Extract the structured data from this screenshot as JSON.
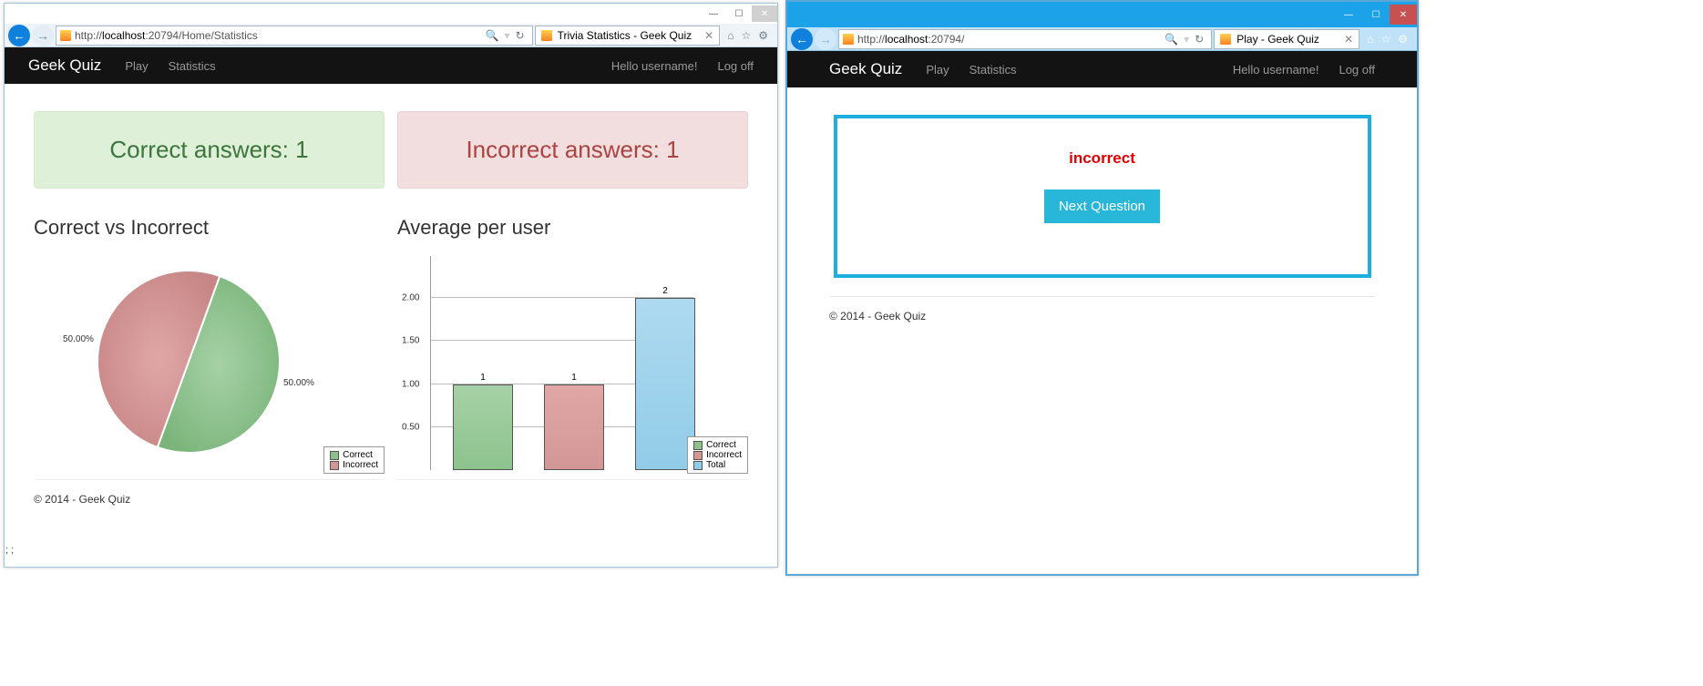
{
  "left_window": {
    "url_prefix": "http://",
    "url_host": "localhost",
    "url_rest": ":20794/Home/Statistics",
    "tab_title": "Trivia Statistics - Geek Quiz",
    "navbar": {
      "brand": "Geek Quiz",
      "play": "Play",
      "stats": "Statistics",
      "greeting": "Hello username!",
      "logoff": "Log off"
    },
    "correct_label": "Correct answers: 1",
    "incorrect_label": "Incorrect answers: 1",
    "pie_heading": "Correct vs Incorrect",
    "bar_heading": "Average per user",
    "pie_legend": {
      "a": "Correct",
      "b": "Incorrect"
    },
    "bar_legend": {
      "a": "Correct",
      "b": "Incorrect",
      "c": "Total"
    },
    "pie_pct_a": "50.00%",
    "pie_pct_b": "50.00%",
    "bar_val_a": "1",
    "bar_val_b": "1",
    "bar_val_c": "2",
    "y0": "0.50",
    "y1": "1.00",
    "y2": "1.50",
    "y3": "2.00",
    "footer": "© 2014 - Geek Quiz"
  },
  "right_window": {
    "url_prefix": "http://",
    "url_host": "localhost",
    "url_rest": ":20794/",
    "tab_title": "Play - Geek Quiz",
    "navbar": {
      "brand": "Geek Quiz",
      "play": "Play",
      "stats": "Statistics",
      "greeting": "Hello username!",
      "logoff": "Log off"
    },
    "result": "incorrect",
    "next": "Next Question",
    "footer": "© 2014 - Geek Quiz"
  },
  "trail": "; ;",
  "chart_data": [
    {
      "type": "pie",
      "title": "Correct vs Incorrect",
      "series": [
        {
          "name": "Correct",
          "value": 50.0,
          "color": "#8dc28d"
        },
        {
          "name": "Incorrect",
          "value": 50.0,
          "color": "#d39696"
        }
      ]
    },
    {
      "type": "bar",
      "title": "Average per user",
      "categories": [
        "Correct",
        "Incorrect",
        "Total"
      ],
      "values": [
        1,
        1,
        2
      ],
      "ylim": [
        0,
        2.5
      ],
      "yticks": [
        0.5,
        1.0,
        1.5,
        2.0
      ],
      "colors": [
        "#8dc28d",
        "#d39696",
        "#91cce8"
      ]
    }
  ]
}
